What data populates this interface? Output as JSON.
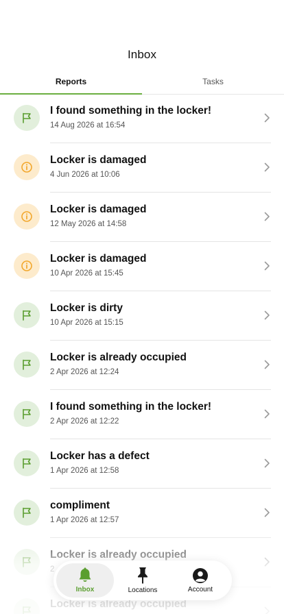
{
  "header": {
    "title": "Inbox"
  },
  "tabs": [
    {
      "label": "Reports",
      "active": true
    },
    {
      "label": "Tasks",
      "active": false
    }
  ],
  "reports": [
    {
      "title": "I found something in the locker!",
      "date": "14 Aug 2026 at 16:54",
      "icon": "flag-icon",
      "color": "green"
    },
    {
      "title": "Locker is damaged",
      "date": "4 Jun 2026 at 10:06",
      "icon": "info-icon",
      "color": "orange"
    },
    {
      "title": "Locker is damaged",
      "date": "12 May 2026 at 14:58",
      "icon": "info-icon",
      "color": "orange"
    },
    {
      "title": "Locker is damaged",
      "date": "10 Apr 2026 at 15:45",
      "icon": "info-icon",
      "color": "orange"
    },
    {
      "title": "Locker is dirty",
      "date": "10 Apr 2026 at 15:15",
      "icon": "flag-icon",
      "color": "green"
    },
    {
      "title": "Locker is already occupied",
      "date": "2 Apr 2026 at 12:24",
      "icon": "flag-icon",
      "color": "green"
    },
    {
      "title": "I found something in the locker!",
      "date": "2 Apr 2026 at 12:22",
      "icon": "flag-icon",
      "color": "green"
    },
    {
      "title": "Locker has a defect",
      "date": "1 Apr 2026 at 12:58",
      "icon": "flag-icon",
      "color": "green"
    },
    {
      "title": "compliment",
      "date": "1 Apr 2026 at 12:57",
      "icon": "flag-icon",
      "color": "green"
    },
    {
      "title": "Locker is already occupied",
      "date": "2",
      "icon": "flag-icon",
      "color": "green"
    },
    {
      "title": "Locker is already occupied",
      "date": "",
      "icon": "flag-icon",
      "color": "green"
    }
  ],
  "nav": [
    {
      "label": "Inbox",
      "icon": "bell-icon",
      "active": true
    },
    {
      "label": "Locations",
      "icon": "pin-icon",
      "active": false
    },
    {
      "label": "Account",
      "icon": "account-icon",
      "active": false
    }
  ],
  "colors": {
    "accent": "#6aae3f",
    "green_bg": "#e2efdc",
    "orange_bg": "#fdebcc",
    "orange": "#f2a72c",
    "green": "#5a9e2f"
  }
}
